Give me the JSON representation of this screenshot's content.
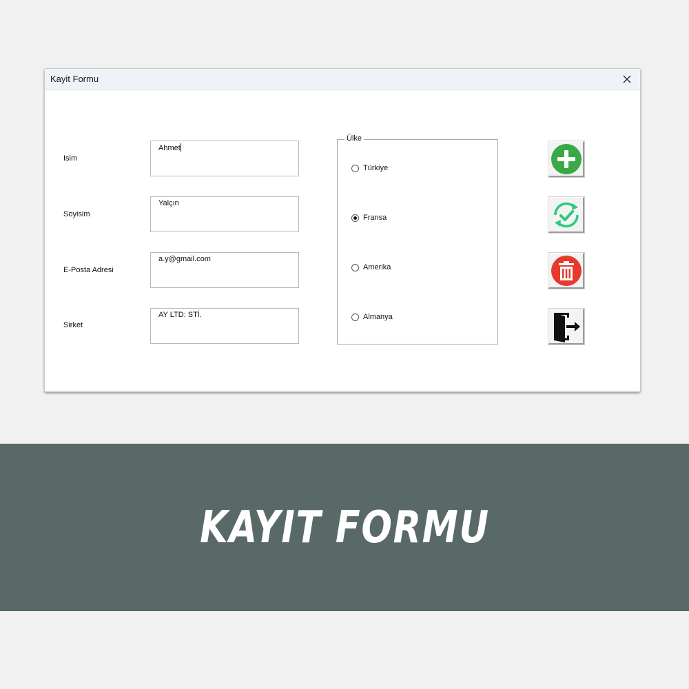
{
  "window": {
    "title": "Kayit Formu"
  },
  "fields": [
    {
      "label": "Isim",
      "value": "Ahmet"
    },
    {
      "label": "Soyisim",
      "value": "Yalçın"
    },
    {
      "label": "E-Posta Adresi",
      "value": "a.y@gmail.com"
    },
    {
      "label": "Sirket",
      "value": "AY LTD: STİ."
    }
  ],
  "country": {
    "legend": "Ülke",
    "options": [
      "Türkiye",
      "Fransa",
      "Amerika",
      "Almanya"
    ],
    "selected": "Fransa"
  },
  "buttons": {
    "add": "add-icon",
    "update": "refresh-check-icon",
    "delete": "trash-icon",
    "exit": "exit-door-icon"
  },
  "colors": {
    "add_green": "#3aa847",
    "update_teal": "#2ec97f",
    "delete_red": "#e53a2c",
    "banner_bg": "#596968"
  },
  "banner": {
    "text": "KAYIT FORMU"
  }
}
